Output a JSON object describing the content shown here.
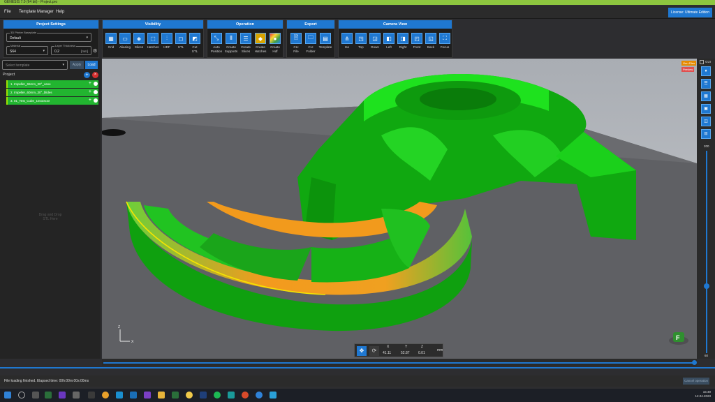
{
  "window": {
    "title": "GENESIS 7.0 (64 bit) - Project.pro"
  },
  "menu": {
    "items": [
      "File",
      "Template Manager",
      "Help"
    ],
    "license": "License: Ultimate Edition"
  },
  "project_settings": {
    "header": "Project Settings",
    "printer_label": "3D Printer Baseplate",
    "printer_value": "Default",
    "material_label": "Material",
    "material_value": "S64",
    "layer_label": "Layer Thickness",
    "layer_value": "0.2",
    "layer_unit": "[mm]"
  },
  "toolbar": {
    "visibility": {
      "header": "Visibility",
      "tools": [
        "Grid",
        "Aliasing",
        "Slices",
        "Hatches",
        "HDF",
        "STL",
        "Cut\nSTL"
      ]
    },
    "operation": {
      "header": "Operation",
      "tools": [
        "Auto\nPosition",
        "Create\nSupports",
        "Create\nSlices",
        "Create\nHatches",
        "Create\nHdf"
      ]
    },
    "export": {
      "header": "Export",
      "tools": [
        "CLI\nFile",
        "CLI\nFolder",
        "Template"
      ]
    },
    "camera": {
      "header": "Camera View",
      "tools": [
        "Iso",
        "Top",
        "Down",
        "Left",
        "Right",
        "Front",
        "Back",
        "Focus"
      ]
    }
  },
  "template": {
    "placeholder": "Select template",
    "apply": "Apply",
    "load": "Load"
  },
  "project": {
    "label": "Project",
    "items": [
      "1. Impeller_65mm_30°_vane",
      "2. Impeller_60mm_30°_blides",
      "3. 01_Test_Cube_10x10x10"
    ],
    "dragdrop": "Drag and Drop\nSTL Here"
  },
  "viewport": {
    "tags": [
      "Gen Files",
      "Preview"
    ],
    "right_checkbox": "GUI",
    "slider_top": "200",
    "slider_bottom": "60",
    "axis": {
      "z": "Z",
      "x": "X"
    }
  },
  "coords": {
    "x_label": "X",
    "y_label": "Y",
    "z_label": "Z",
    "x_value": "41.11",
    "y_value": "52.87",
    "z_value": "0.01",
    "unit": "mm"
  },
  "status": {
    "text": "File loading finished. Elapsed time: 00h:00m:00s:00ms",
    "cancel": "Cancel operation"
  },
  "clock": {
    "time": "15:49",
    "date": "12.04.2023"
  },
  "colors": {
    "accent": "#1f78d1",
    "brand": "#8dc63f",
    "model_green": "#16c116"
  }
}
